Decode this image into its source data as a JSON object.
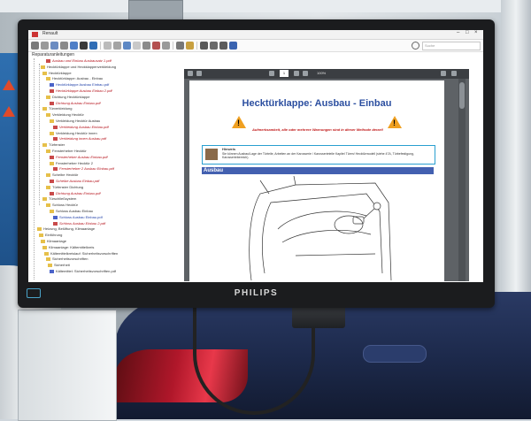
{
  "app": {
    "window_title": "Renault",
    "search_placeholder": "Suche"
  },
  "tree": {
    "header": "Reparaturanleitungen",
    "rows": [
      {
        "indent": 14,
        "icon": "doc-red",
        "style": "red",
        "label": "Ausbau und Einbau Ausbausatz 1.pdf"
      },
      {
        "indent": 8,
        "icon": "folder",
        "style": "",
        "label": "Hecktürklappe und Heckklappenverkleidung"
      },
      {
        "indent": 10,
        "icon": "folder",
        "style": "",
        "label": "Hecktürklappe"
      },
      {
        "indent": 14,
        "icon": "folder",
        "style": "",
        "label": "Hecktürklappe: Ausbau - Einbau"
      },
      {
        "indent": 18,
        "icon": "doc",
        "style": "blue",
        "label": "Hecktürklappe Ausbau Einbau.pdf"
      },
      {
        "indent": 18,
        "icon": "doc-red",
        "style": "red",
        "label": "Hecktürklappe Ausbau Einbau 2.pdf"
      },
      {
        "indent": 14,
        "icon": "folder",
        "style": "",
        "label": "Dichtung Hecktürklappe"
      },
      {
        "indent": 18,
        "icon": "doc-red",
        "style": "red",
        "label": "Dichtung Ausbau Einbau.pdf"
      },
      {
        "indent": 10,
        "icon": "folder",
        "style": "",
        "label": "Türverkleidung"
      },
      {
        "indent": 14,
        "icon": "folder",
        "style": "",
        "label": "Verkleidung Hecktür"
      },
      {
        "indent": 18,
        "icon": "folder",
        "style": "",
        "label": "Verkleidung Hecktür Ausbau"
      },
      {
        "indent": 22,
        "icon": "doc-red",
        "style": "red",
        "label": "Verkleidung Ausbau Einbau.pdf"
      },
      {
        "indent": 18,
        "icon": "folder",
        "style": "",
        "label": "Verkleidung Hecktür innen"
      },
      {
        "indent": 22,
        "icon": "doc-red",
        "style": "red",
        "label": "Verkleidung innen Ausbau.pdf"
      },
      {
        "indent": 10,
        "icon": "folder",
        "style": "",
        "label": "Türfenster"
      },
      {
        "indent": 14,
        "icon": "folder",
        "style": "",
        "label": "Fensterheber Hecktür"
      },
      {
        "indent": 18,
        "icon": "doc-red",
        "style": "red",
        "label": "Fensterheber Ausbau Einbau.pdf"
      },
      {
        "indent": 18,
        "icon": "folder",
        "style": "",
        "label": "Fensterheber Hecktür 2"
      },
      {
        "indent": 22,
        "icon": "doc-red",
        "style": "red",
        "label": "Fensterheber 2 Ausbau Einbau.pdf"
      },
      {
        "indent": 14,
        "icon": "folder",
        "style": "",
        "label": "Scheibe Hecktür"
      },
      {
        "indent": 18,
        "icon": "doc-red",
        "style": "red",
        "label": "Scheibe Ausbau Einbau.pdf"
      },
      {
        "indent": 14,
        "icon": "folder",
        "style": "",
        "label": "Türfenster Dichtung"
      },
      {
        "indent": 18,
        "icon": "doc-red",
        "style": "red",
        "label": "Dichtung Ausbau Einbau.pdf"
      },
      {
        "indent": 10,
        "icon": "folder",
        "style": "",
        "label": "Türschließsystem"
      },
      {
        "indent": 14,
        "icon": "folder",
        "style": "",
        "label": "Schloss Hecktür"
      },
      {
        "indent": 18,
        "icon": "folder",
        "style": "",
        "label": "Schloss Ausbau Einbau"
      },
      {
        "indent": 22,
        "icon": "doc",
        "style": "blue",
        "label": "Schloss Ausbau Einbau.pdf"
      },
      {
        "indent": 22,
        "icon": "doc-red",
        "style": "red",
        "label": "Schloss Ausbau Einbau 2.pdf"
      },
      {
        "indent": 4,
        "icon": "folder",
        "style": "",
        "label": "Heizung, Belüftung, Klimaanlage"
      },
      {
        "indent": 6,
        "icon": "folder",
        "style": "",
        "label": "Einführung"
      },
      {
        "indent": 8,
        "icon": "folder",
        "style": "",
        "label": "Klimaanlage"
      },
      {
        "indent": 10,
        "icon": "folder",
        "style": "",
        "label": "Klimaanlage: Kältemittelkreis"
      },
      {
        "indent": 12,
        "icon": "folder",
        "style": "",
        "label": "Kältemittelkreislauf: Sicherheitsvorschriften"
      },
      {
        "indent": 14,
        "icon": "folder",
        "style": "",
        "label": "Sicherheitsvorschriften"
      },
      {
        "indent": 16,
        "icon": "folder",
        "style": "",
        "label": "Sicherheit"
      },
      {
        "indent": 18,
        "icon": "doc",
        "style": "",
        "label": "Kältemittel: Sicherheitsvorschriften.pdf"
      }
    ]
  },
  "pdf": {
    "page_number": "1",
    "zoom": "100%",
    "doc_title": "Hecktürklappe: Ausbau - Einbau",
    "warning_text": "Aufmerksamkeit, alle oder mehrere Warnungen sind in dieser Methode derart!",
    "hint_label": "Hinweis",
    "hint_text": "Sie können Ausbau/Lage der Türteile, Arbeiten an der Karosserie / Karosserieteile Kapitel Türen/ Hecktürmodell (siehe 47A, Türbefestigung, Karosseriebereich).",
    "section": "Ausbau"
  },
  "monitor": {
    "brand": "PHILIPS"
  },
  "colors": {
    "accent_blue": "#2c4fa0",
    "warning_red": "#c01818",
    "section_blue": "#4360b0",
    "hint_border": "#2a9fd0"
  }
}
